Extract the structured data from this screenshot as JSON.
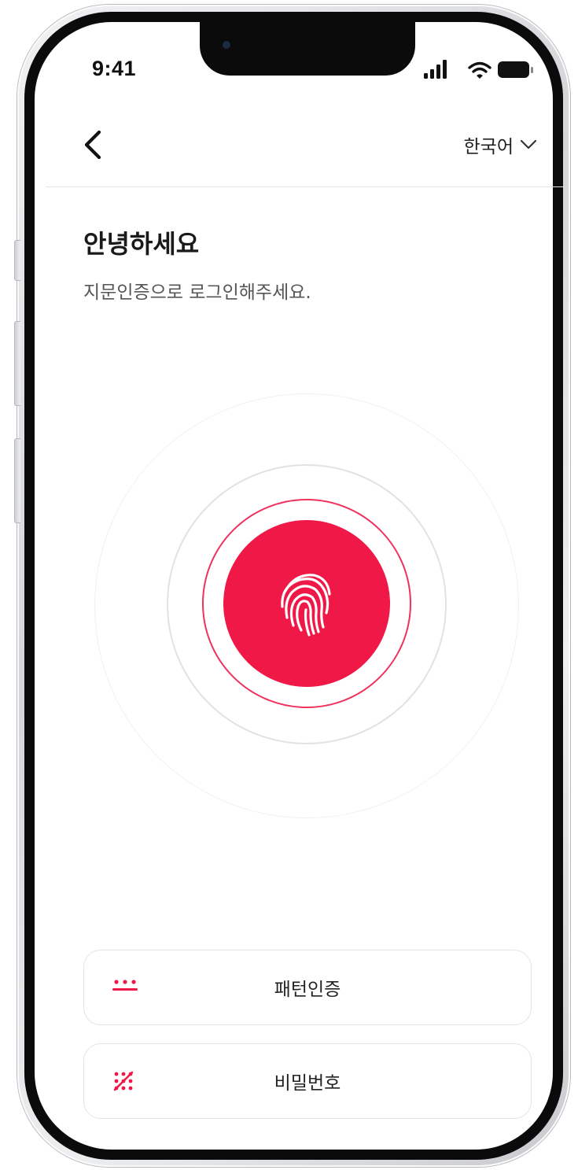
{
  "status_bar": {
    "time": "9:41",
    "icons": [
      "signal-icon",
      "wifi-icon",
      "battery-icon"
    ]
  },
  "header": {
    "back_icon": "chevron-left-icon",
    "language_label": "한국어",
    "language_icon": "chevron-down-icon"
  },
  "main": {
    "greeting": "안녕하세요",
    "instruction": "지문인증으로 로그인해주세요.",
    "fingerprint_icon": "fingerprint-icon"
  },
  "auth_options": [
    {
      "label": "패턴인증",
      "icon": "pattern-icon"
    },
    {
      "label": "비밀번호",
      "icon": "password-keypad-icon"
    }
  ],
  "colors": {
    "accent": "#f01846",
    "accent_ring": "#f0315e",
    "ring_gray": "#e2e2e4",
    "text_primary": "#1a1a1a",
    "text_secondary": "#555555"
  }
}
